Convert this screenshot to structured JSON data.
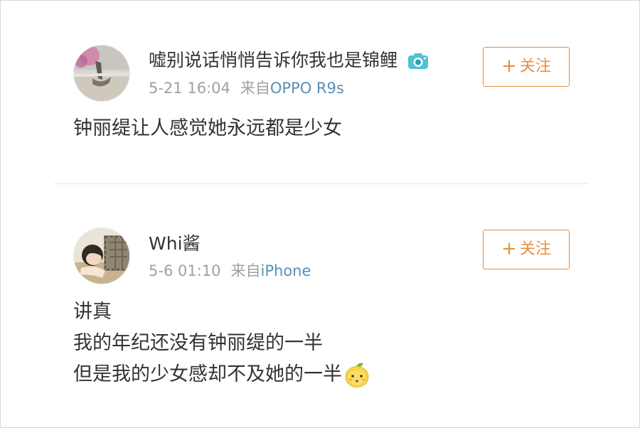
{
  "posts": [
    {
      "username": "嘘别说话悄悄告诉你我也是锦鲤",
      "badge_icon": "camera-badge-icon",
      "time": "5-21 16:04",
      "source_prefix": "来自",
      "device": "OPPO R9s",
      "follow_label": "关注",
      "follow_plus": "+",
      "content": [
        "钟丽缇让人感觉她永远都是少女"
      ]
    },
    {
      "username": "Whi酱",
      "time": "5-6 01:10",
      "source_prefix": "来自",
      "device": "iPhone",
      "follow_label": "关注",
      "follow_plus": "+",
      "content": [
        "讲真",
        "我的年纪还没有钟丽缇的一半",
        "但是我的少女感却不及她的一半"
      ],
      "content_emoji": "lemon-face-emoji-icon"
    }
  ],
  "colors": {
    "accent": "#e98f3e",
    "device_link": "#5b8fb5",
    "meta_gray": "#a0a0a0",
    "text": "#333333"
  }
}
